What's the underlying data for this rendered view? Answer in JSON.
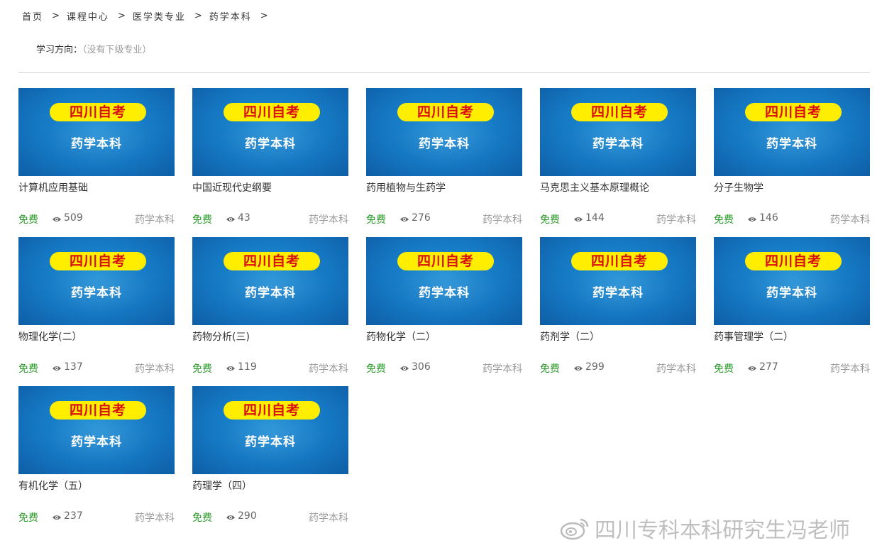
{
  "breadcrumb": {
    "items": [
      "首页",
      "课程中心",
      "医学类专业",
      "药学本科"
    ],
    "sep": ">"
  },
  "direction": {
    "label": "学习方向：",
    "value": "（没有下级专业）"
  },
  "courses": [
    {
      "title": "计算机应用基础",
      "price": "免费",
      "views": "509",
      "category": "药学本科",
      "banner": "四川自考",
      "subtitle": "药学本科"
    },
    {
      "title": "中国近现代史纲要",
      "price": "免费",
      "views": "43",
      "category": "药学本科",
      "banner": "四川自考",
      "subtitle": "药学本科"
    },
    {
      "title": "药用植物与生药学",
      "price": "免费",
      "views": "276",
      "category": "药学本科",
      "banner": "四川自考",
      "subtitle": "药学本科"
    },
    {
      "title": "马克思主义基本原理概论",
      "price": "免费",
      "views": "144",
      "category": "药学本科",
      "banner": "四川自考",
      "subtitle": "药学本科"
    },
    {
      "title": "分子生物学",
      "price": "免费",
      "views": "146",
      "category": "药学本科",
      "banner": "四川自考",
      "subtitle": "药学本科"
    },
    {
      "title": "物理化学(二）",
      "price": "免费",
      "views": "137",
      "category": "药学本科",
      "banner": "四川自考",
      "subtitle": "药学本科"
    },
    {
      "title": "药物分析(三)",
      "price": "免费",
      "views": "119",
      "category": "药学本科",
      "banner": "四川自考",
      "subtitle": "药学本科"
    },
    {
      "title": "药物化学（二）",
      "price": "免费",
      "views": "306",
      "category": "药学本科",
      "banner": "四川自考",
      "subtitle": "药学本科"
    },
    {
      "title": "药剂学（二）",
      "price": "免费",
      "views": "299",
      "category": "药学本科",
      "banner": "四川自考",
      "subtitle": "药学本科"
    },
    {
      "title": "药事管理学（二）",
      "price": "免费",
      "views": "277",
      "category": "药学本科",
      "banner": "四川自考",
      "subtitle": "药学本科"
    },
    {
      "title": "有机化学（五）",
      "price": "免费",
      "views": "237",
      "category": "药学本科",
      "banner": "四川自考",
      "subtitle": "药学本科"
    },
    {
      "title": "药理学（四）",
      "price": "免费",
      "views": "290",
      "category": "药学本科",
      "banner": "四川自考",
      "subtitle": "药学本科"
    }
  ],
  "icons": {
    "views": "eye-icon",
    "watermark": "weibo-icon"
  },
  "colors": {
    "free": "#2a9a2a",
    "banner_pill": "#ffee00",
    "banner_text": "#d90f0f",
    "thumb_bg": "#1577c2"
  },
  "watermark": "四川专科本科研究生冯老师"
}
